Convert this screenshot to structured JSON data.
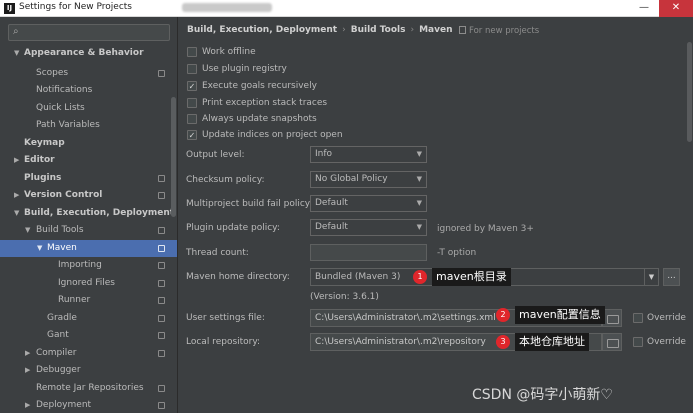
{
  "window": {
    "title": "Settings for New Projects",
    "app_icon": "IJ",
    "minimize_icon": "—",
    "close_icon": "✕"
  },
  "sidebar": {
    "search_icon": "⌕",
    "items": [
      {
        "label": "Appearance & Behavior",
        "bold": true
      },
      {
        "label": "Scopes"
      },
      {
        "label": "Notifications"
      },
      {
        "label": "Quick Lists"
      },
      {
        "label": "Path Variables"
      },
      {
        "label": "Keymap",
        "bold": true
      },
      {
        "label": "Editor",
        "bold": true
      },
      {
        "label": "Plugins",
        "bold": true
      },
      {
        "label": "Version Control",
        "bold": true
      },
      {
        "label": "Build, Execution, Deployment",
        "bold": true
      },
      {
        "label": "Build Tools"
      },
      {
        "label": "Maven"
      },
      {
        "label": "Importing"
      },
      {
        "label": "Ignored Files"
      },
      {
        "label": "Runner"
      },
      {
        "label": "Gradle"
      },
      {
        "label": "Gant"
      },
      {
        "label": "Compiler"
      },
      {
        "label": "Debugger"
      },
      {
        "label": "Remote Jar Repositories"
      },
      {
        "label": "Deployment"
      }
    ]
  },
  "breadcrumb": {
    "part1": "Build, Execution, Deployment",
    "part2": "Build Tools",
    "part3": "Maven",
    "separator": "›"
  },
  "for_new_projects": "For new projects",
  "checkboxes": [
    {
      "label": "Work offline",
      "checked": false
    },
    {
      "label": "Use plugin registry",
      "checked": false
    },
    {
      "label": "Execute goals recursively",
      "checked": true
    },
    {
      "label": "Print exception stack traces",
      "checked": false
    },
    {
      "label": "Always update snapshots",
      "checked": false
    },
    {
      "label": "Update indices on project open",
      "checked": true
    }
  ],
  "check_mark": "✓",
  "fields": {
    "output_level": {
      "label": "Output level:",
      "value": "Info"
    },
    "checksum_policy": {
      "label": "Checksum policy:",
      "value": "No Global Policy"
    },
    "multiproject_policy": {
      "label": "Multiproject build fail policy:",
      "value": "Default"
    },
    "plugin_update_policy": {
      "label": "Plugin update policy:",
      "value": "Default",
      "hint": "ignored by Maven 3+"
    },
    "thread_count": {
      "label": "Thread count:",
      "value": "",
      "hint": "-T option"
    },
    "maven_home": {
      "label": "Maven home directory:",
      "value": "Bundled (Maven 3)",
      "version": "(Version: 3.6.1)"
    },
    "user_settings": {
      "label": "User settings file:",
      "value": "C:\\Users\\Administrator\\.m2\\settings.xml",
      "override": "Override"
    },
    "local_repository": {
      "label": "Local repository:",
      "value": "C:\\Users\\Administrator\\.m2\\repository",
      "override": "Override"
    }
  },
  "ellipsis": "...",
  "caret": "▼",
  "annotations": [
    {
      "number": "1",
      "text": "maven根目录"
    },
    {
      "number": "2",
      "text": "maven配置信息"
    },
    {
      "number": "3",
      "text": "本地仓库地址"
    }
  ],
  "watermark": "CSDN @码字小萌新♡",
  "colors": {
    "selection": "#4b6eaf",
    "badge": "#e0262b",
    "background": "#3c3f41"
  }
}
